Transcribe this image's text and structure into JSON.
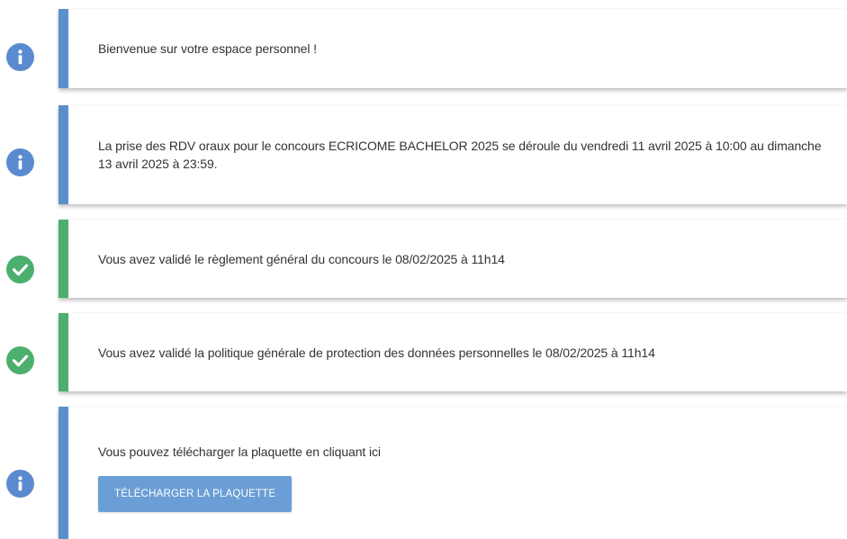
{
  "colors": {
    "info_accent": "#5b8fcb",
    "success_accent": "#4caf6d",
    "info_icon": "#5a8bd0",
    "success_icon": "#4caf6d",
    "button_bg": "#6b9ed6"
  },
  "messages": [
    {
      "type": "info",
      "icon": "info-icon",
      "text": "Bienvenue sur votre espace personnel !"
    },
    {
      "type": "info",
      "icon": "info-icon",
      "text": "La prise des RDV oraux pour le concours ECRICOME BACHELOR 2025 se déroule du vendredi 11 avril 2025 à 10:00 au dimanche 13 avril 2025 à 23:59."
    },
    {
      "type": "success",
      "icon": "check-circle-icon",
      "text": "Vous avez validé le règlement général du concours le 08/02/2025 à 11h14"
    },
    {
      "type": "success",
      "icon": "check-circle-icon",
      "text": "Vous avez validé la politique générale de protection des données personnelles le 08/02/2025 à 11h14"
    },
    {
      "type": "info",
      "icon": "info-icon",
      "text": "Vous pouvez télécharger la plaquette en cliquant ici",
      "button_label": "TÉLÉCHARGER LA PLAQUETTE"
    }
  ]
}
